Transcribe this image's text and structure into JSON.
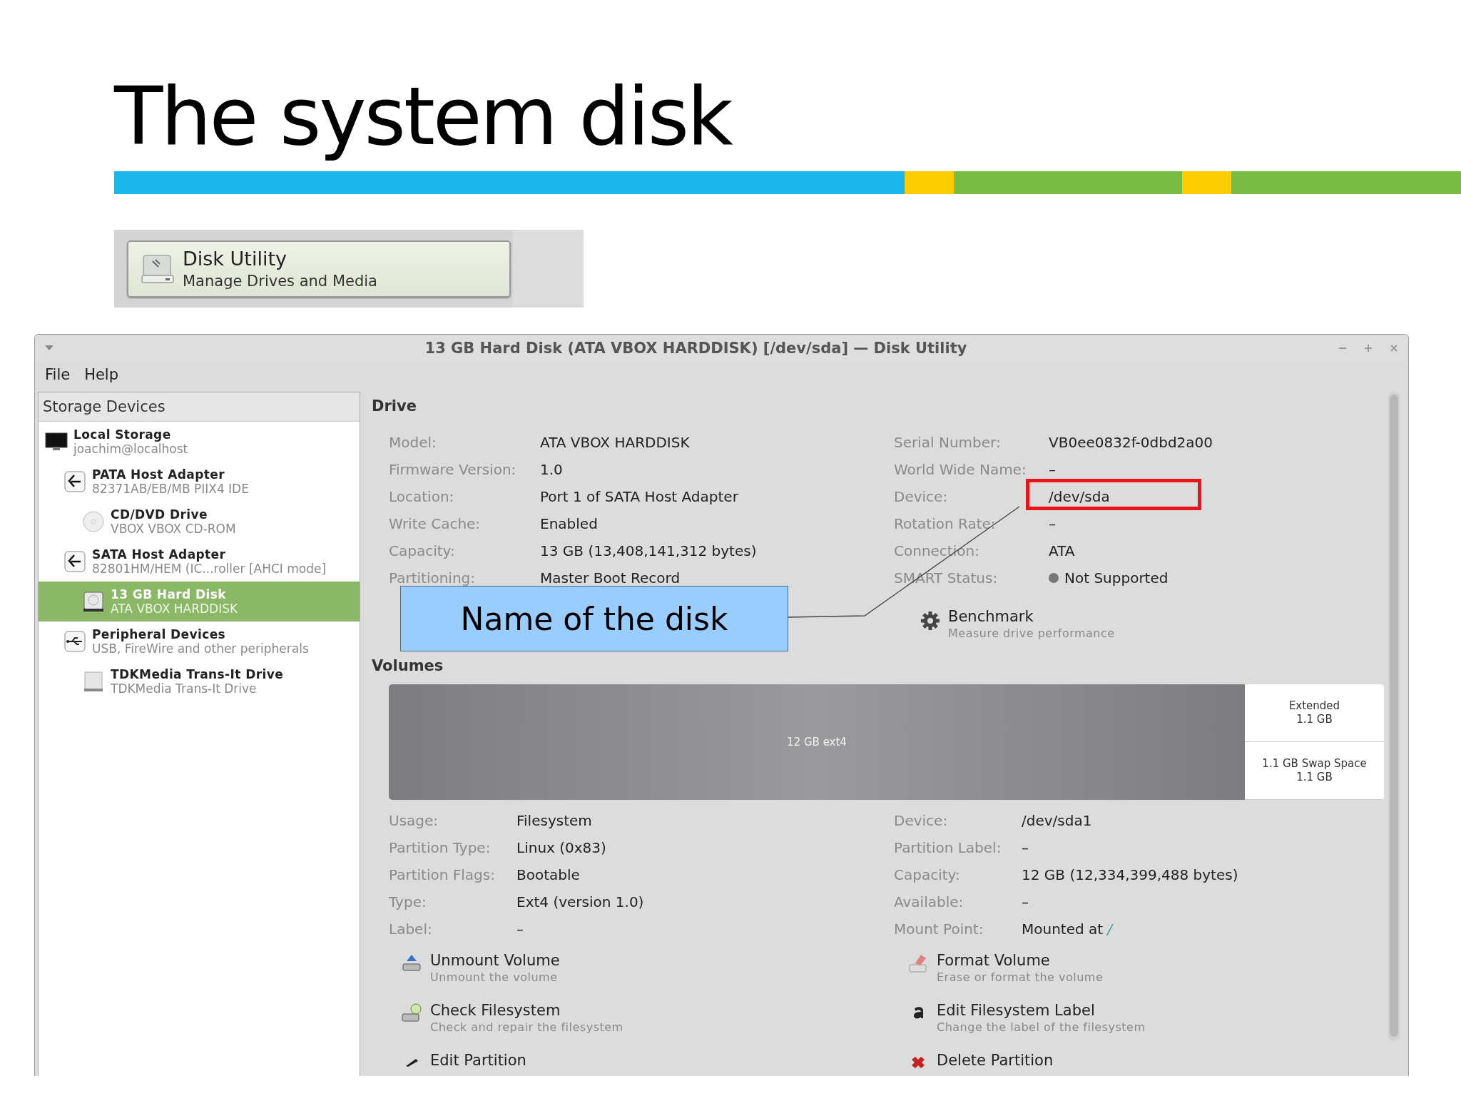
{
  "slide": {
    "title": "The system disk"
  },
  "launcher": {
    "title": "Disk Utility",
    "subtitle": "Manage Drives and Media"
  },
  "window": {
    "title": "13 GB Hard Disk (ATA VBOX HARDDISK) [/dev/sda] — Disk Utility",
    "menu": [
      "File",
      "Help"
    ]
  },
  "sidebar": {
    "header": "Storage Devices",
    "items": [
      {
        "kind": "computer",
        "name": "Local Storage",
        "detail": "joachim@localhost",
        "selected": false,
        "children": [
          {
            "kind": "adapter",
            "name": "PATA Host Adapter",
            "detail": "82371AB/EB/MB PIIX4 IDE",
            "selected": false,
            "children": [
              {
                "kind": "optical",
                "name": "CD/DVD Drive",
                "detail": "VBOX VBOX CD-ROM",
                "selected": false
              }
            ]
          },
          {
            "kind": "adapter",
            "name": "SATA Host Adapter",
            "detail": "82801HM/HEM (IC...roller [AHCI mode]",
            "selected": false,
            "children": [
              {
                "kind": "disk",
                "name": "13 GB Hard Disk",
                "detail": "ATA VBOX HARDDISK",
                "selected": true
              }
            ]
          },
          {
            "kind": "usb",
            "name": "Peripheral Devices",
            "detail": "USB, FireWire and other peripherals",
            "selected": false,
            "children": [
              {
                "kind": "removable",
                "name": "TDKMedia Trans-It Drive",
                "detail": "TDKMedia Trans-It Drive",
                "selected": false
              }
            ]
          }
        ]
      }
    ]
  },
  "drive": {
    "heading": "Drive",
    "fields_left": [
      {
        "label": "Model:",
        "value": "ATA VBOX HARDDISK"
      },
      {
        "label": "Firmware Version:",
        "value": "1.0"
      },
      {
        "label": "Location:",
        "value": "Port 1 of SATA Host Adapter"
      },
      {
        "label": "Write Cache:",
        "value": "Enabled"
      },
      {
        "label": "Capacity:",
        "value": "13 GB (13,408,141,312 bytes)"
      },
      {
        "label": "Partitioning:",
        "value": "Master Boot Record"
      }
    ],
    "fields_right": [
      {
        "kind": "text",
        "label": "Serial Number:",
        "value": "VB0ee0832f-0dbd2a00",
        "highlighted": false
      },
      {
        "kind": "text",
        "label": "World Wide Name:",
        "value": "–",
        "highlighted": false
      },
      {
        "kind": "text",
        "label": "Device:",
        "value": "/dev/sda",
        "highlighted": true
      },
      {
        "kind": "text",
        "label": "Rotation Rate:",
        "value": "–",
        "highlighted": false
      },
      {
        "kind": "text",
        "label": "Connection:",
        "value": "ATA",
        "highlighted": false
      },
      {
        "kind": "status",
        "label": "SMART Status:",
        "value": "Not Supported",
        "highlighted": false
      }
    ],
    "benchmark": {
      "title": "Benchmark",
      "subtitle": "Measure drive performance"
    }
  },
  "callout": {
    "text": "Name of the disk"
  },
  "volumes": {
    "heading": "Volumes",
    "segments": [
      {
        "lines": [
          "12 GB ext4"
        ],
        "selected": true
      },
      {
        "lines": [
          "Extended",
          "1.1 GB"
        ],
        "selected": false
      },
      {
        "lines": [
          "1.1 GB Swap Space",
          "1.1 GB"
        ],
        "selected": false
      }
    ],
    "fields_left": [
      {
        "label": "Usage:",
        "value": "Filesystem"
      },
      {
        "label": "Partition Type:",
        "value": "Linux (0x83)"
      },
      {
        "label": "Partition Flags:",
        "value": "Bootable"
      },
      {
        "label": "Type:",
        "value": "Ext4 (version 1.0)"
      },
      {
        "label": "Label:",
        "value": "–"
      }
    ],
    "fields_right": [
      {
        "label": "Device:",
        "value": "/dev/sda1"
      },
      {
        "label": "Partition Label:",
        "value": "–"
      },
      {
        "label": "Capacity:",
        "value": "12 GB (12,334,399,488 bytes)"
      },
      {
        "label": "Available:",
        "value": "–"
      },
      {
        "label": "Mount Point:",
        "value": "Mounted at",
        "link": "/"
      }
    ],
    "actions_left": [
      {
        "kind": "unmount",
        "title": "Unmount Volume",
        "subtitle": "Unmount the volume"
      },
      {
        "kind": "check",
        "title": "Check Filesystem",
        "subtitle": "Check and repair the filesystem"
      },
      {
        "kind": "edit",
        "title": "Edit Partition"
      }
    ],
    "actions_right": [
      {
        "kind": "format",
        "title": "Format Volume",
        "subtitle": "Erase or format the volume"
      },
      {
        "kind": "label",
        "title": "Edit Filesystem Label",
        "subtitle": "Change the label of the filesystem"
      },
      {
        "kind": "delete",
        "title": "Delete Partition"
      }
    ]
  }
}
